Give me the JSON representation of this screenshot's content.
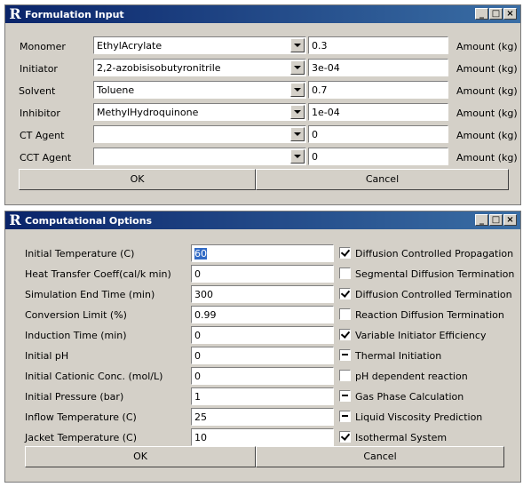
{
  "formulation": {
    "title": "Formulation Input",
    "ok": "OK",
    "cancel": "Cancel",
    "rows": [
      {
        "label": "Monomer",
        "selected": "EthylAcrylate",
        "amount": "0.3",
        "unit": "Amount (kg)"
      },
      {
        "label": "Initiator",
        "selected": "2,2-azobisisobutyronitrile",
        "amount": "3e-04",
        "unit": "Amount (kg)"
      },
      {
        "label": "Solvent",
        "selected": "Toluene",
        "amount": "0.7",
        "unit": "Amount (kg)"
      },
      {
        "label": "Inhibitor",
        "selected": "MethylHydroquinone",
        "amount": "1e-04",
        "unit": "Amount (kg)"
      },
      {
        "label": "CT Agent",
        "selected": "",
        "amount": "0",
        "unit": "Amount (kg)"
      },
      {
        "label": "CCT Agent",
        "selected": "",
        "amount": "0",
        "unit": "Amount (kg)"
      }
    ]
  },
  "computational": {
    "title": "Computational Options",
    "ok": "OK",
    "cancel": "Cancel",
    "rows": [
      {
        "label": "Initial Temperature (C)",
        "value": "60",
        "option": "Diffusion Controlled Propagation",
        "state": "checked"
      },
      {
        "label": "Heat Transfer Coeff(cal/k min)",
        "value": "0",
        "option": "Segmental Diffusion Termination",
        "state": "unchecked"
      },
      {
        "label": "Simulation End Time (min)",
        "value": "300",
        "option": "Diffusion Controlled Termination",
        "state": "checked"
      },
      {
        "label": "Conversion Limit (%)",
        "value": "0.99",
        "option": "Reaction Diffusion Termination",
        "state": "unchecked"
      },
      {
        "label": "Induction Time (min)",
        "value": "0",
        "option": "Variable Initiator Efficiency",
        "state": "checked"
      },
      {
        "label": "Initial pH",
        "value": "0",
        "option": "Thermal Initiation",
        "state": "mixed"
      },
      {
        "label": "Initial Cationic Conc. (mol/L)",
        "value": "0",
        "option": "pH dependent reaction",
        "state": "unchecked"
      },
      {
        "label": "Initial Pressure (bar)",
        "value": "1",
        "option": "Gas Phase Calculation",
        "state": "mixed"
      },
      {
        "label": "Inflow Temperature  (C)",
        "value": "25",
        "option": "Liquid Viscosity Prediction",
        "state": "mixed"
      },
      {
        "label": "Jacket Temperature (C)",
        "value": "10",
        "option": "Isothermal System",
        "state": "checked"
      }
    ]
  }
}
